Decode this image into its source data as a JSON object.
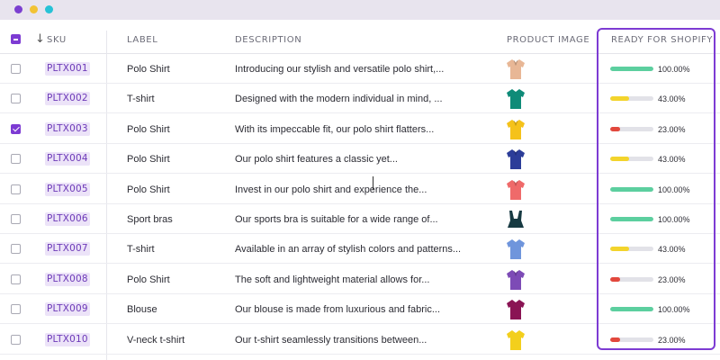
{
  "colors": {
    "accent": "#7d3bd3",
    "dots": [
      "#7b3fd0",
      "#f2c335",
      "#27c2d6"
    ],
    "status_full": "#5ccf9f",
    "status_mid": "#f3d42c",
    "status_low": "#e2483d"
  },
  "table": {
    "headers": {
      "sku": "SKU",
      "label": "LABEL",
      "description": "DESCRIPTION",
      "product_image": "PRODUCT IMAGE",
      "ready": "READY FOR SHOPIFY"
    },
    "rows": [
      {
        "checked": false,
        "sku": "PLTX001",
        "label": "Polo Shirt",
        "description": "Introducing our stylish and versatile polo shirt,...",
        "image": "polo-shirt-beige",
        "image_color": "#e8b796",
        "ready": 100,
        "ready_text": "100.00%"
      },
      {
        "checked": false,
        "sku": "PLTX002",
        "label": "T-shirt",
        "description": "Designed with the modern individual in mind, ...",
        "image": "tshirt-teal",
        "image_color": "#0f8b78",
        "ready": 43,
        "ready_text": "43.00%"
      },
      {
        "checked": true,
        "sku": "PLTX003",
        "label": "Polo Shirt",
        "description": "With its impeccable fit, our polo shirt flatters...",
        "image": "polo-shirt-yellow",
        "image_color": "#f5c21a",
        "ready": 23,
        "ready_text": "23.00%"
      },
      {
        "checked": false,
        "sku": "PLTX004",
        "label": "Polo Shirt",
        "description": "Our polo shirt features a classic yet...",
        "image": "polo-shirt-navy",
        "image_color": "#2c3d99",
        "ready": 43,
        "ready_text": "43.00%"
      },
      {
        "checked": false,
        "sku": "PLTX005",
        "label": "Polo Shirt",
        "description": "Invest in our polo shirt and experience the...",
        "image": "polo-shirt-coral",
        "image_color": "#ef6a6a",
        "ready": 100,
        "ready_text": "100.00%"
      },
      {
        "checked": false,
        "sku": "PLTX006",
        "label": "Sport bras",
        "description": "Our sports bra is suitable for a wide range of...",
        "image": "sports-bra-dark",
        "image_color": "#173a42",
        "ready": 100,
        "ready_text": "100.00%"
      },
      {
        "checked": false,
        "sku": "PLTX007",
        "label": "T-shirt",
        "description": "Available in an array of stylish colors and patterns...",
        "image": "tshirt-blue",
        "image_color": "#6f95dc",
        "ready": 43,
        "ready_text": "43.00%"
      },
      {
        "checked": false,
        "sku": "PLTX008",
        "label": "Polo Shirt",
        "description": "The soft and lightweight material allows for...",
        "image": "polo-shirt-purple",
        "image_color": "#7d4bb6",
        "ready": 23,
        "ready_text": "23.00%"
      },
      {
        "checked": false,
        "sku": "PLTX009",
        "label": "Blouse",
        "description": "Our blouse is made from luxurious and fabric...",
        "image": "blouse-magenta",
        "image_color": "#8a1454",
        "ready": 100,
        "ready_text": "100.00%"
      },
      {
        "checked": false,
        "sku": "PLTX010",
        "label": "V-neck t-shirt",
        "description": "Our t-shirt seamlessly transitions between...",
        "image": "vneck-yellow",
        "image_color": "#f3cf1c",
        "ready": 23,
        "ready_text": "23.00%"
      }
    ]
  }
}
